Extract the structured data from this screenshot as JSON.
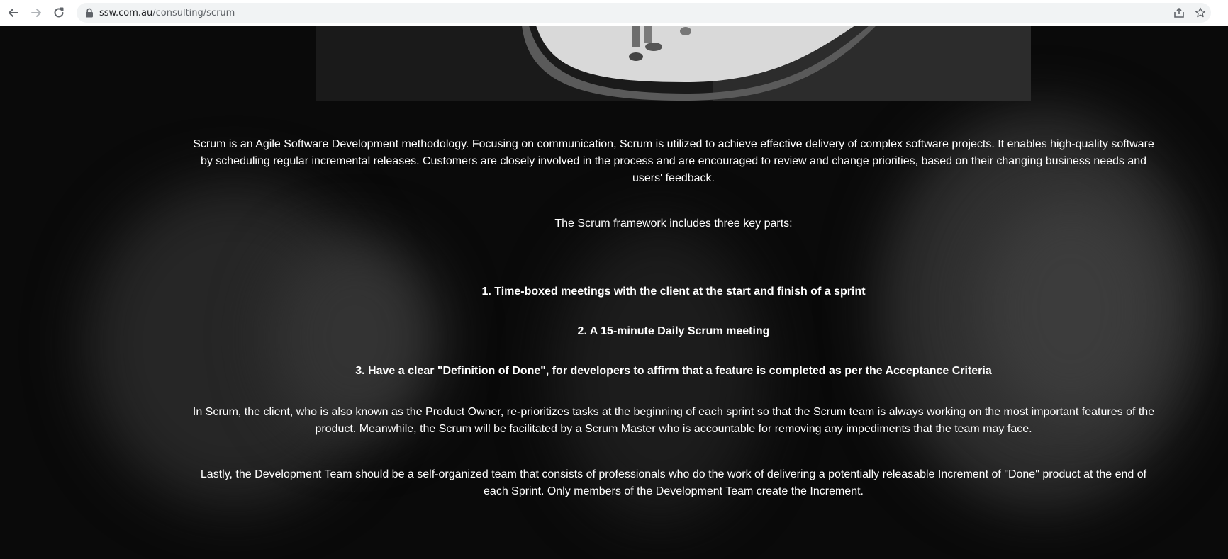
{
  "browser": {
    "url_domain": "ssw.com.au",
    "url_path": "/consulting/scrum",
    "icons": [
      "back-icon",
      "forward-icon",
      "reload-icon",
      "lock-icon",
      "share-icon",
      "bookmark-star-icon"
    ]
  },
  "content": {
    "intro": "Scrum is an Agile Software Development methodology. Focusing on communication, Scrum is utilized to achieve effective delivery of complex software projects. It enables high-quality software by scheduling regular incremental releases. Customers are closely involved in the process and are encouraged to review and change priorities, based on their changing business needs and users' feedback.",
    "framework_intro": "The Scrum framework includes three key parts:",
    "key_parts": [
      "1. Time-boxed meetings with the client at the start and finish of a sprint",
      "2. A 15-minute Daily Scrum meeting",
      "3. Have a clear \"Definition of Done\", for developers to affirm that a feature is completed as per the Acceptance Criteria"
    ],
    "product_owner": "In Scrum, the client, who is also known as the Product Owner, re-prioritizes tasks at the beginning of each sprint so that the Scrum team is always working on the most important features of the product. Meanwhile, the Scrum will be facilitated by a Scrum Master who is accountable for removing any impediments that the team may face.",
    "dev_team": "Lastly, the Development Team should be a self-organized team that consists of professionals who do the work of delivering a potentially releasable Increment of \"Done\" product at the end of each Sprint. Only members of the Development Team create the Increment."
  },
  "colors": {
    "page_background": "#0a0a0a",
    "text": "#ffffff",
    "omnibox": "#f1f3f4"
  }
}
